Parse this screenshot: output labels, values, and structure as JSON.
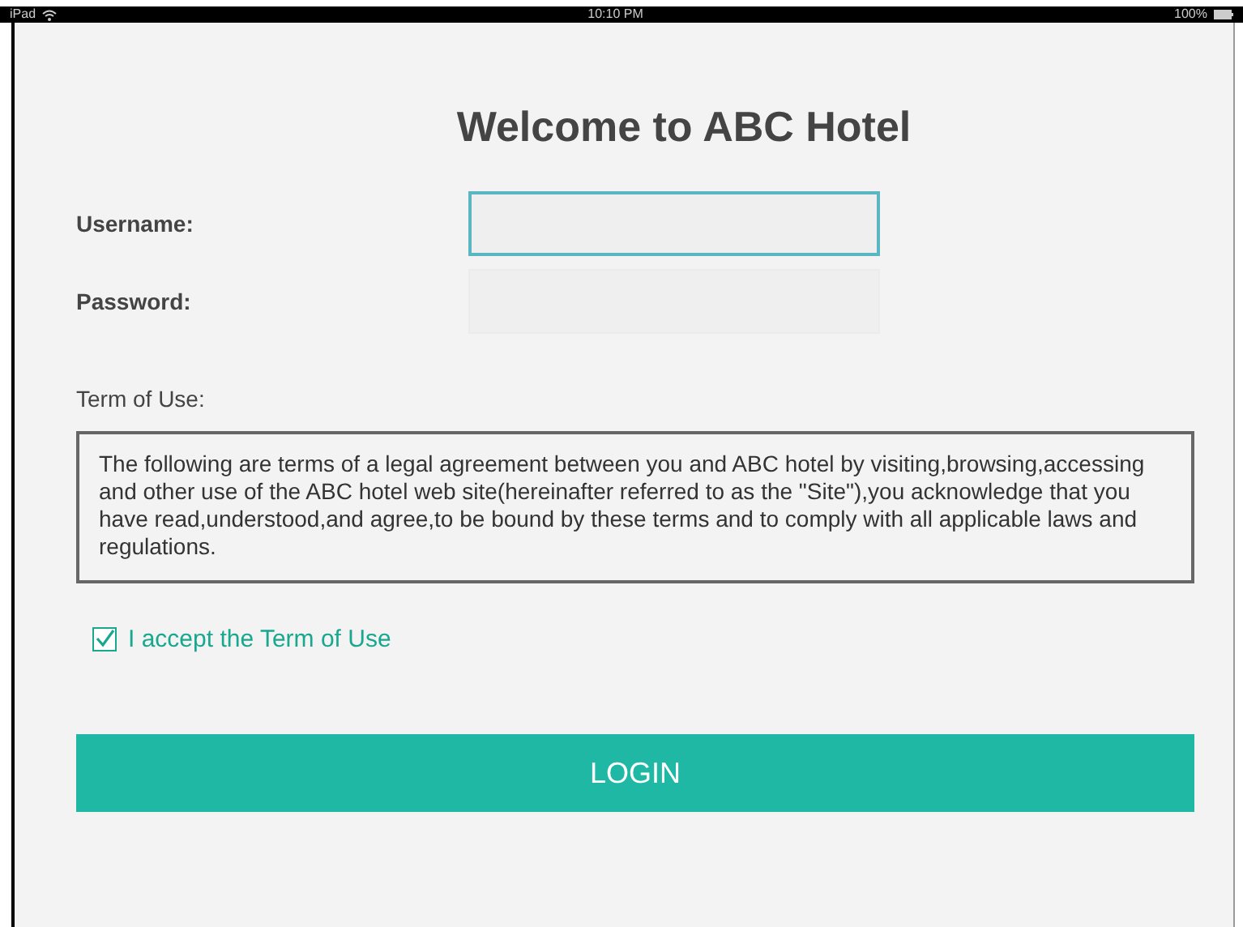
{
  "status_bar": {
    "device": "iPad",
    "time": "10:10 PM",
    "battery": "100%"
  },
  "title": "Welcome to ABC Hotel",
  "fields": [
    {
      "label": "Username:",
      "focused": true
    },
    {
      "label": "Password:",
      "focused": false
    }
  ],
  "terms": {
    "label": "Term of Use:",
    "text": "The following are terms of a legal agreement between you and ABC hotel by visiting,browsing,accessing and other use of the ABC hotel web site(hereinafter referred to as the \"Site\"),you acknowledge that you have read,understood,and agree,to be bound by these terms and to comply with all applicable laws and regulations."
  },
  "accept": {
    "label": "I accept the Term of Use",
    "checked": true
  },
  "login_button": "LOGIN"
}
